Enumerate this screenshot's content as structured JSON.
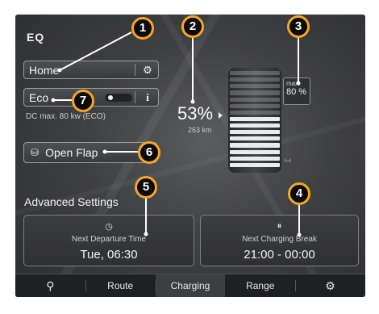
{
  "brand": {
    "logo": "EQ"
  },
  "profile": {
    "label": "Home",
    "settings_icon": "gear-icon"
  },
  "mode": {
    "label": "Eco",
    "info_icon": "info-icon",
    "detail": "DC max. 80 kw (ECO)"
  },
  "state_of_charge": {
    "percent": "53%",
    "range": "263 km",
    "level_fraction": 0.53
  },
  "max_charge": {
    "label": "max.",
    "value": "80 %"
  },
  "open_flap": {
    "label": "Open Flap",
    "icon": "charging-flap-icon"
  },
  "advanced": {
    "title": "Advanced Settings"
  },
  "departure": {
    "title": "Next Departure Time",
    "value": "Tue, 06:30",
    "icon": "clock-icon"
  },
  "charging_break": {
    "title": "Next Charging Break",
    "value": "21:00 - 00:00",
    "icon": "pause-clock-icon"
  },
  "tabs": [
    {
      "label": "",
      "icon": "search-icon"
    },
    {
      "label": "Route"
    },
    {
      "label": "Charging",
      "active": true
    },
    {
      "label": "Range"
    },
    {
      "label": "",
      "icon": "gear-icon"
    }
  ],
  "callouts": [
    "1",
    "2",
    "3",
    "4",
    "5",
    "6",
    "7"
  ],
  "colors": {
    "callout_ring": "#f5a623",
    "callout_fill": "#0a0a0a",
    "screen_bg": "#3f4042"
  }
}
